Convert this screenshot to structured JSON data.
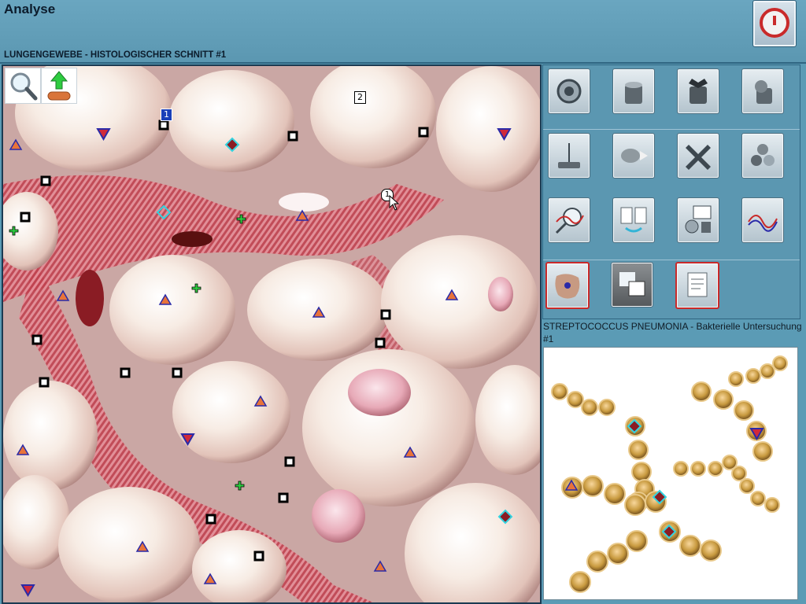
{
  "header": {
    "title": "Analyse"
  },
  "section": {
    "label": "LUNGENGEWEBE - HISTOLOGISCHER SCHNITT #1"
  },
  "viewer": {
    "tools": [
      {
        "name": "magnifier-tool",
        "icon": "magnifier-icon"
      },
      {
        "name": "upload-tool",
        "icon": "upload-arrow-icon"
      }
    ],
    "marker_badges": [
      "1",
      "2"
    ],
    "cursor_badge": "1"
  },
  "toolbar": {
    "rows": [
      [
        "target-lens-icon",
        "container-open-icon",
        "container-bat-icon",
        "container-creature-icon"
      ],
      [
        "balance-scale-icon",
        "creature-arrow-icon",
        "x-shape-icon",
        "molecule-spheres-icon"
      ],
      [
        "magnify-graph-icon",
        "pages-swap-icon",
        "camera-lens-icon",
        "wave-graph-icon"
      ],
      [
        "cell-sample-icon",
        "zoom-window-icon",
        "notes-document-icon"
      ]
    ]
  },
  "bacteria_panel": {
    "caption": "STREPTOCOCCUS PNEUMONIA - Bakterielle Untersuchung #1"
  },
  "colors": {
    "background": "#5b9bb5",
    "accent_red": "#c92a2a",
    "marker_orange": "#e8733a",
    "marker_blue": "#2a2aa8",
    "marker_cyan": "#33d3e0"
  }
}
